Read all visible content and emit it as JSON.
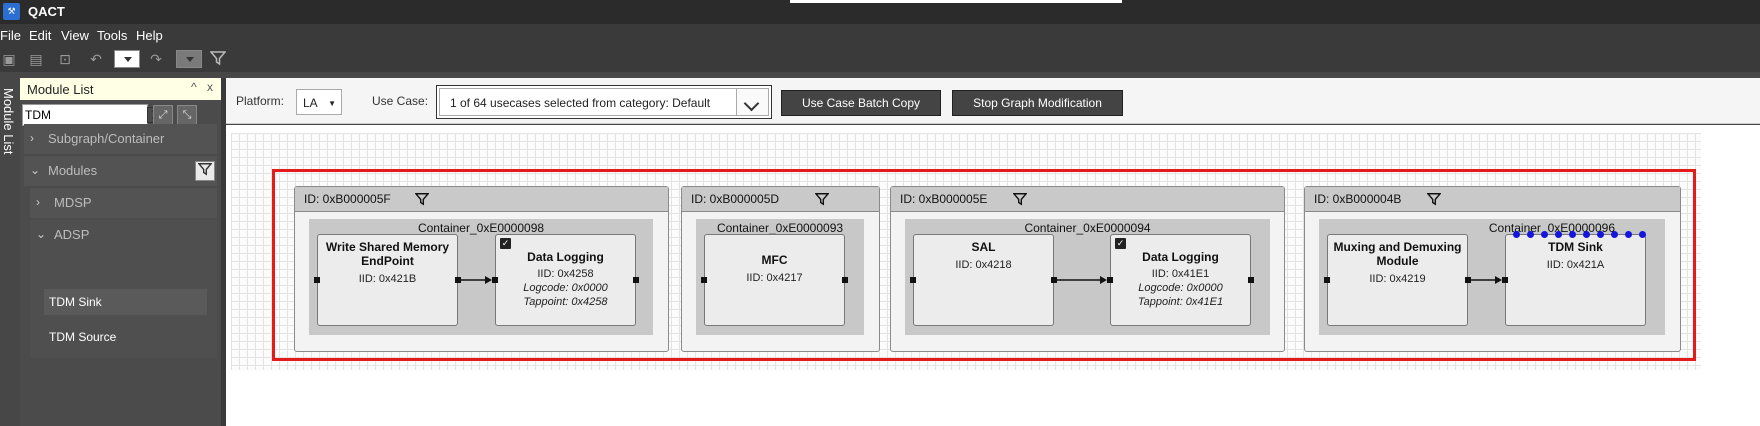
{
  "app": {
    "title": "QACT",
    "logo": "qact-logo"
  },
  "menu": [
    "File",
    "Edit",
    "View",
    "Tools",
    "Help"
  ],
  "toolbar": {
    "icons": [
      "save-icon",
      "save-all-icon",
      "settings-icon",
      "undo-icon",
      "dropdown",
      "redo-icon",
      "dropdown",
      "filter-icon"
    ]
  },
  "side_tab": {
    "label": "Module List"
  },
  "module_panel": {
    "title": "Module List",
    "pin": "^",
    "close": "x",
    "search": {
      "value": "TDM",
      "clear": "X",
      "caret": "▾"
    },
    "expand_icon": "expand-icon",
    "collapse_icon": "collapse-icon",
    "groups": [
      {
        "label": "Subgraph/Container",
        "expanded": false
      },
      {
        "label": "Modules",
        "expanded": true
      },
      {
        "label": "MDSP",
        "expanded": false
      },
      {
        "label": "ADSP",
        "expanded": true
      }
    ],
    "leaves": [
      {
        "label": "TDM Sink",
        "selected": true
      },
      {
        "label": "TDM Source",
        "selected": false
      }
    ]
  },
  "controls": {
    "platform_label": "Platform:",
    "platform_value": "LA",
    "platform_caret": "▼",
    "use_case_label": "Use Case:",
    "use_case_value": "1 of 64 usecases selected from category: Default",
    "batch_copy_label": "Use Case Batch Copy",
    "stop_modification_label": "Stop Graph Modification"
  },
  "graph": {
    "selection_color": "#e31b1b",
    "subgraphs": [
      {
        "id_label": "ID: 0xB000005F",
        "container": "Container_0xE0000098",
        "modules": [
          {
            "title_lines": [
              "Write Shared Memory",
              "EndPoint"
            ],
            "lines": [
              "IID: 0x421B"
            ],
            "checked": false
          },
          {
            "title_lines": [
              "Data Logging"
            ],
            "lines": [
              "IID: 0x4258",
              "Logcode: 0x0000",
              "Tappoint: 0x4258"
            ],
            "checked": true
          }
        ]
      },
      {
        "id_label": "ID: 0xB000005D",
        "container": "Container_0xE0000093",
        "modules": [
          {
            "title_lines": [
              "MFC"
            ],
            "lines": [
              "IID: 0x4217"
            ],
            "checked": false
          }
        ]
      },
      {
        "id_label": "ID: 0xB000005E",
        "container": "Container_0xE0000094",
        "modules": [
          {
            "title_lines": [
              "SAL"
            ],
            "lines": [
              "IID: 0x4218"
            ],
            "checked": false
          },
          {
            "title_lines": [
              "Data Logging"
            ],
            "lines": [
              "IID: 0x41E1",
              "Logcode: 0x0000",
              "Tappoint: 0x41E1"
            ],
            "checked": true
          }
        ]
      },
      {
        "id_label": "ID: 0xB000004B",
        "container": "Container_0xE0000096",
        "modules": [
          {
            "title_lines": [
              "Muxing and Demuxing",
              "Module"
            ],
            "lines": [
              "IID: 0x4219"
            ],
            "checked": false
          },
          {
            "title_lines": [
              "TDM Sink"
            ],
            "lines": [
              "IID: 0x421A"
            ],
            "checked": false
          }
        ]
      }
    ]
  }
}
